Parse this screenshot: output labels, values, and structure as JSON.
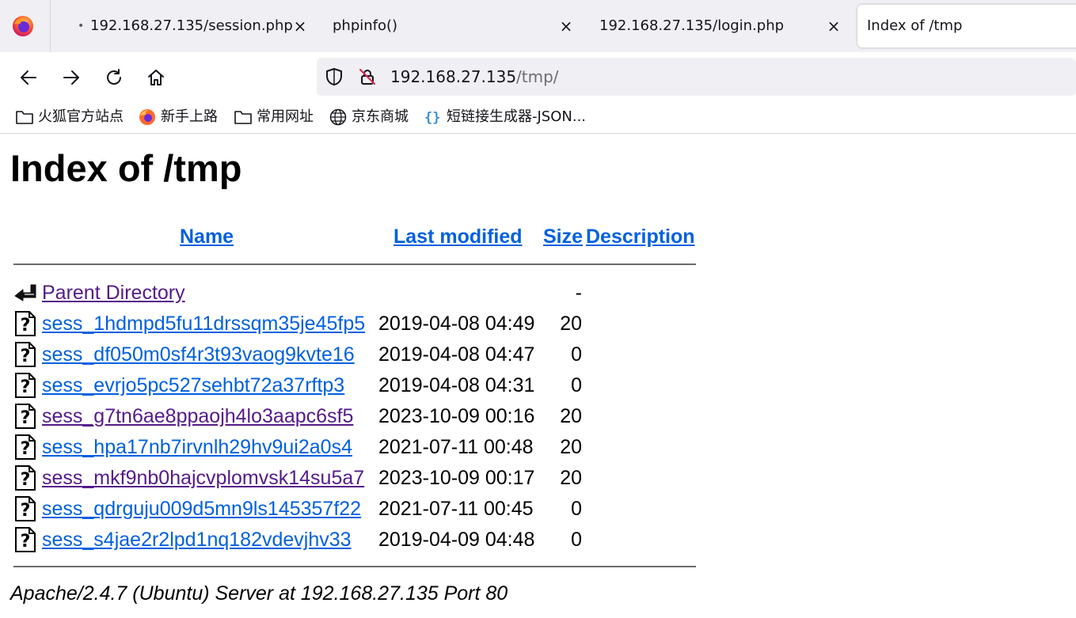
{
  "tabs": [
    {
      "title": "192.168.27.135/session.php",
      "attention_dot": "•",
      "close": "×"
    },
    {
      "title": "phpinfo()",
      "close": "×"
    },
    {
      "title": "192.168.27.135/login.php",
      "close": "×"
    },
    {
      "title": "Index of /tmp",
      "active": true
    }
  ],
  "url": {
    "host": "192.168.27.135",
    "path": "/tmp/"
  },
  "bookmarks": [
    {
      "label": "火狐官方站点",
      "icon": "folder-icon"
    },
    {
      "label": "新手上路",
      "icon": "firefox-icon"
    },
    {
      "label": "常用网址",
      "icon": "folder-icon"
    },
    {
      "label": "京东商城",
      "icon": "globe-icon"
    },
    {
      "label": "短链接生成器-JSON...",
      "icon": "braces-icon"
    }
  ],
  "page": {
    "heading": "Index of /tmp",
    "columns": {
      "name": "Name",
      "modified": "Last modified",
      "size": "Size",
      "description": "Description"
    },
    "parent": {
      "name": "Parent Directory",
      "size": "-"
    },
    "files": [
      {
        "name": "sess_1hdmpd5fu11drssqm35je45fp5",
        "modified": "2019-04-08 04:49",
        "size": "20",
        "visited": false
      },
      {
        "name": "sess_df050m0sf4r3t93vaog9kvte16",
        "modified": "2019-04-08 04:47",
        "size": "0",
        "visited": false
      },
      {
        "name": "sess_evrjo5pc527sehbt72a37rftp3",
        "modified": "2019-04-08 04:31",
        "size": "0",
        "visited": false
      },
      {
        "name": "sess_g7tn6ae8ppaojh4lo3aapc6sf5",
        "modified": "2023-10-09 00:16",
        "size": "20",
        "visited": true
      },
      {
        "name": "sess_hpa17nb7irvnlh29hv9ui2a0s4",
        "modified": "2021-07-11 00:48",
        "size": "20",
        "visited": false
      },
      {
        "name": "sess_mkf9nb0hajcvplomvsk14su5a7",
        "modified": "2023-10-09 00:17",
        "size": "20",
        "visited": true
      },
      {
        "name": "sess_qdrguju009d5mn9ls145357f22",
        "modified": "2021-07-11 00:45",
        "size": "0",
        "visited": false
      },
      {
        "name": "sess_s4jae2r2lpd1nq182vdevjhv33",
        "modified": "2019-04-09 04:48",
        "size": "0",
        "visited": false
      }
    ],
    "footer": "Apache/2.4.7 (Ubuntu) Server at 192.168.27.135 Port 80"
  },
  "colors": {
    "link": "#0060df",
    "visited": "#551a8b",
    "tabstrip": "#f0f0f4"
  }
}
